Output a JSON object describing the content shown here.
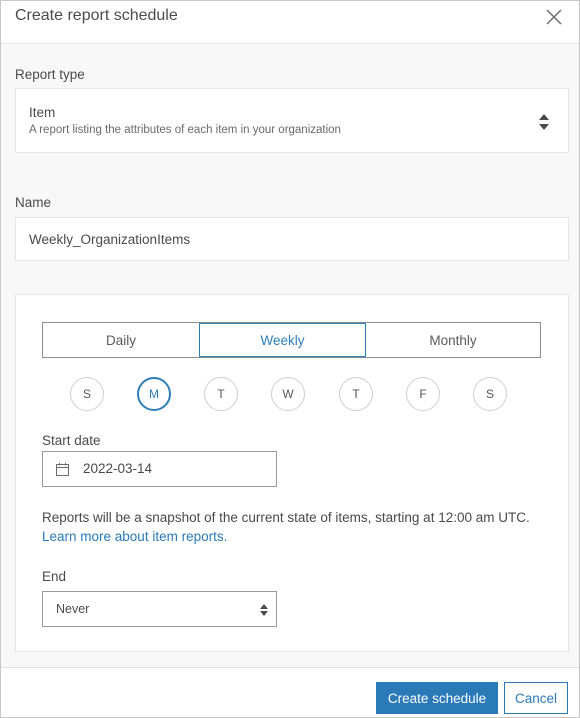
{
  "dialog": {
    "title": "Create report schedule"
  },
  "report_type": {
    "label": "Report type",
    "selected_title": "Item",
    "selected_description": "A report listing the attributes of each item in your organization"
  },
  "name": {
    "label": "Name",
    "value": "Weekly_OrganizationItems"
  },
  "frequency": {
    "options": [
      "Daily",
      "Weekly",
      "Monthly"
    ],
    "selected": "Weekly"
  },
  "days": {
    "items": [
      "S",
      "M",
      "T",
      "W",
      "T",
      "F",
      "S"
    ],
    "selected_index": 1
  },
  "start_date": {
    "label": "Start date",
    "value": "2022-03-14"
  },
  "info": {
    "text": "Reports will be a snapshot of the current state of items, starting at 12:00 am UTC.",
    "link": "Learn more about item reports."
  },
  "end": {
    "label": "End",
    "value": "Never"
  },
  "footer": {
    "create_label": "Create schedule",
    "cancel_label": "Cancel"
  },
  "colors": {
    "accent": "#2b7ab8",
    "link": "#2a7ab5",
    "panel_bg": "#f8f8f8"
  }
}
